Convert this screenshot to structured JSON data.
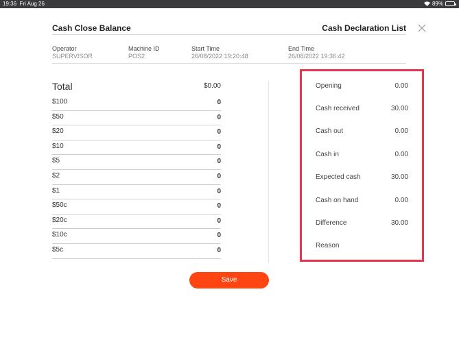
{
  "status_bar": {
    "time": "19:36",
    "date": "Fri Aug 26",
    "battery": "89%",
    "battery_level": 0.89
  },
  "header": {
    "left_title": "Cash Close Balance",
    "right_title": "Cash Declaration List",
    "close_icon": "close-icon"
  },
  "meta": [
    {
      "label": "Operator",
      "value": "SUPERVISOR"
    },
    {
      "label": "Machine ID",
      "value": "POS2"
    },
    {
      "label": "Start Time",
      "value": "26/08/2022 19:20:48"
    },
    {
      "label": "End Time",
      "value": "26/08/2022 19:36:42"
    }
  ],
  "total": {
    "label": "Total",
    "value": "$0.00"
  },
  "denominations": [
    {
      "name": "$100",
      "qty": "0"
    },
    {
      "name": "$50",
      "qty": "0"
    },
    {
      "name": "$20",
      "qty": "0"
    },
    {
      "name": "$10",
      "qty": "0"
    },
    {
      "name": "$5",
      "qty": "0"
    },
    {
      "name": "$2",
      "qty": "0"
    },
    {
      "name": "$1",
      "qty": "0"
    },
    {
      "name": "$50c",
      "qty": "0"
    },
    {
      "name": "$20c",
      "qty": "0"
    },
    {
      "name": "$10c",
      "qty": "0"
    },
    {
      "name": "$5c",
      "qty": "0"
    }
  ],
  "summary": [
    {
      "label": "Opening",
      "value": "0.00"
    },
    {
      "label": "Cash received",
      "value": "30.00"
    },
    {
      "label": "Cash out",
      "value": "0.00"
    },
    {
      "label": "Cash in",
      "value": "0.00"
    },
    {
      "label": "Expected cash",
      "value": "30.00"
    },
    {
      "label": "Cash on hand",
      "value": "0.00"
    },
    {
      "label": "Difference",
      "value": "30.00"
    },
    {
      "label": "Reason",
      "value": ""
    }
  ],
  "save_label": "Save",
  "colors": {
    "accent": "#ff4512",
    "highlight_border": "#e8344e"
  }
}
